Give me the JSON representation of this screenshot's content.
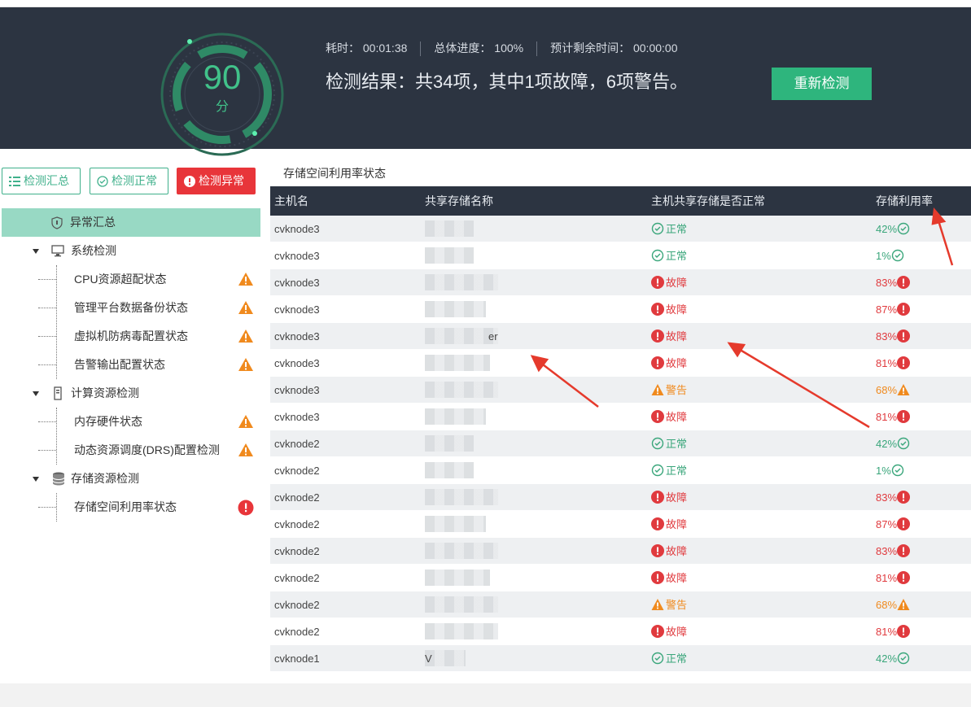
{
  "header": {
    "score": "90",
    "score_unit": "分",
    "elapsed": "耗时： 00:01:38",
    "progress": "总体进度： 100%",
    "remaining": "预计剩余时间： 00:00:00",
    "result": "检测结果：共34项，其中1项故障，6项警告。",
    "retest_label": "重新检测",
    "accent": "#2eb57d"
  },
  "tabs": [
    {
      "label": "检测汇总",
      "icon": "list-icon"
    },
    {
      "label": "检测正常",
      "icon": "check-circle-icon"
    },
    {
      "label": "检测异常",
      "icon": "alert-circle-icon"
    }
  ],
  "tree": {
    "summary": "异常汇总",
    "groups": [
      {
        "label": "系统检测",
        "icon": "monitor-icon",
        "items": [
          {
            "label": "CPU资源超配状态",
            "status": "warning"
          },
          {
            "label": "管理平台数据备份状态",
            "status": "warning"
          },
          {
            "label": "虚拟机防病毒配置状态",
            "status": "warning"
          },
          {
            "label": "告警输出配置状态",
            "status": "warning"
          }
        ]
      },
      {
        "label": "计算资源检测",
        "icon": "server-icon",
        "items": [
          {
            "label": "内存硬件状态",
            "status": "warning"
          },
          {
            "label": "动态资源调度(DRS)配置检测",
            "status": "warning"
          }
        ]
      },
      {
        "label": "存储资源检测",
        "icon": "database-icon",
        "items": [
          {
            "label": "存储空间利用率状态",
            "status": "error"
          }
        ]
      }
    ]
  },
  "section_title": "存储空间利用率状态",
  "table": {
    "columns": [
      "主机名",
      "共享存储名称",
      "主机共享存储是否正常",
      "存储利用率"
    ],
    "status_labels": {
      "ok": "正常",
      "error": "故障",
      "warning": "警告"
    },
    "rows": [
      {
        "host": "cvknode3",
        "storage": "",
        "status": "ok",
        "usage": "42%"
      },
      {
        "host": "cvknode3",
        "storage": "",
        "status": "ok",
        "usage": "1%"
      },
      {
        "host": "cvknode3",
        "storage": "",
        "status": "error",
        "usage": "83%"
      },
      {
        "host": "cvknode3",
        "storage": "",
        "status": "error",
        "usage": "87%"
      },
      {
        "host": "cvknode3",
        "storage": "er",
        "status": "error",
        "usage": "83%"
      },
      {
        "host": "cvknode3",
        "storage": "",
        "status": "error",
        "usage": "81%"
      },
      {
        "host": "cvknode3",
        "storage": "",
        "status": "warning",
        "usage": "68%"
      },
      {
        "host": "cvknode3",
        "storage": "",
        "status": "error",
        "usage": "81%"
      },
      {
        "host": "cvknode2",
        "storage": "",
        "status": "ok",
        "usage": "42%"
      },
      {
        "host": "cvknode2",
        "storage": "",
        "status": "ok",
        "usage": "1%"
      },
      {
        "host": "cvknode2",
        "storage": "",
        "status": "error",
        "usage": "83%"
      },
      {
        "host": "cvknode2",
        "storage": "",
        "status": "error",
        "usage": "87%"
      },
      {
        "host": "cvknode2",
        "storage": "",
        "status": "error",
        "usage": "83%"
      },
      {
        "host": "cvknode2",
        "storage": "",
        "status": "error",
        "usage": "81%"
      },
      {
        "host": "cvknode2",
        "storage": "",
        "status": "warning",
        "usage": "68%"
      },
      {
        "host": "cvknode2",
        "storage": "",
        "status": "error",
        "usage": "81%"
      },
      {
        "host": "cvknode1",
        "storage": "V",
        "status": "ok",
        "usage": "42%"
      }
    ]
  },
  "colors": {
    "ok": "#3aa67b",
    "error": "#e03a3e",
    "warning": "#f08a1e",
    "header_bg": "#2c3441",
    "selected_bg": "#98d9c4"
  }
}
